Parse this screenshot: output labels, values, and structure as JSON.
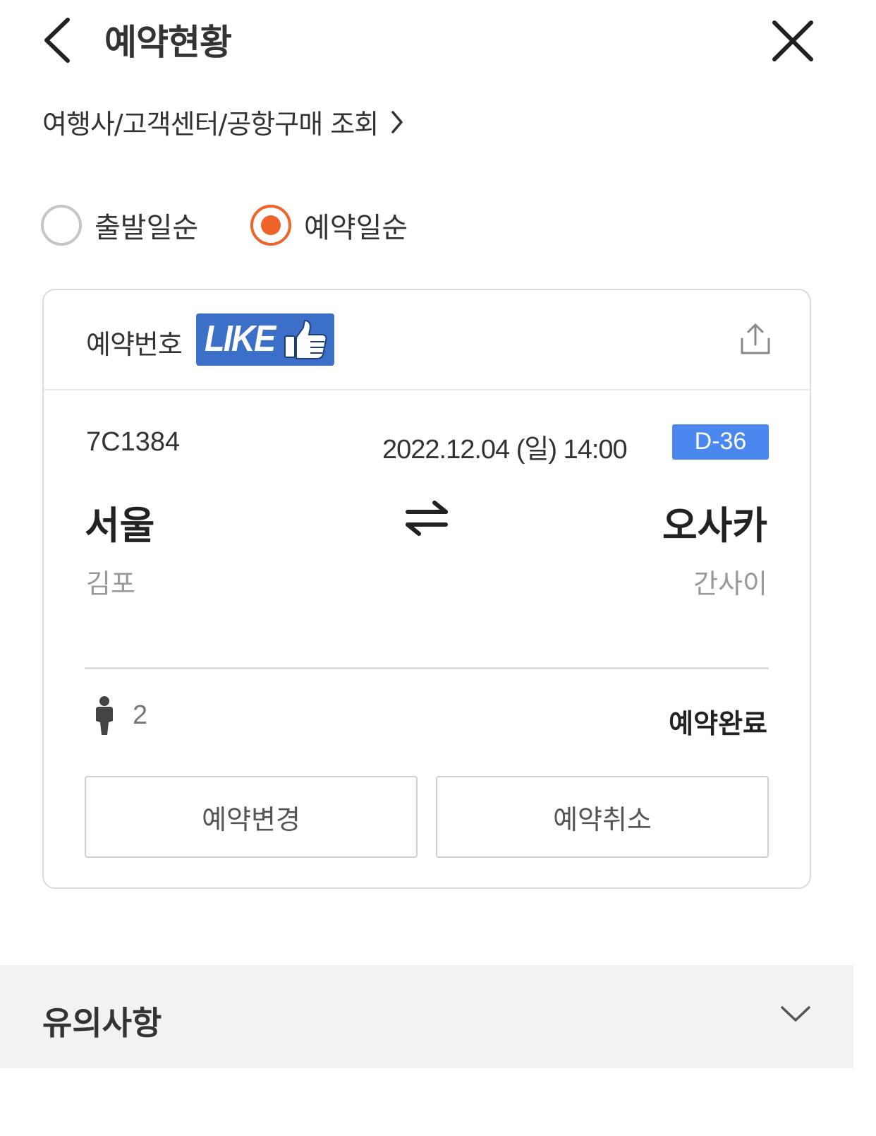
{
  "header": {
    "title": "예약현황"
  },
  "agency_link": {
    "label": "여행사/고객센터/공항구매 조회"
  },
  "sort": {
    "options": [
      {
        "label": "출발일순",
        "selected": false
      },
      {
        "label": "예약일순",
        "selected": true
      }
    ],
    "accent_color": "#f0642c"
  },
  "reservation": {
    "number_label": "예약번호",
    "badge_text": "LIKE",
    "flight_number": "7C1384",
    "datetime": "2022.12.04 (일) 14:00",
    "dday": "D-36",
    "dday_color": "#4a88f0",
    "from_city": "서울",
    "from_airport": "김포",
    "to_city": "오사카",
    "to_airport": "간사이",
    "passengers": "2",
    "status": "예약완료",
    "change_label": "예약변경",
    "cancel_label": "예약취소"
  },
  "notice": {
    "title": "유의사항"
  },
  "icons": [
    "back-arrow-icon",
    "close-icon",
    "chevron-right-icon",
    "thumbs-up-icon",
    "share-icon",
    "swap-arrows-icon",
    "person-icon",
    "chevron-down-icon"
  ]
}
